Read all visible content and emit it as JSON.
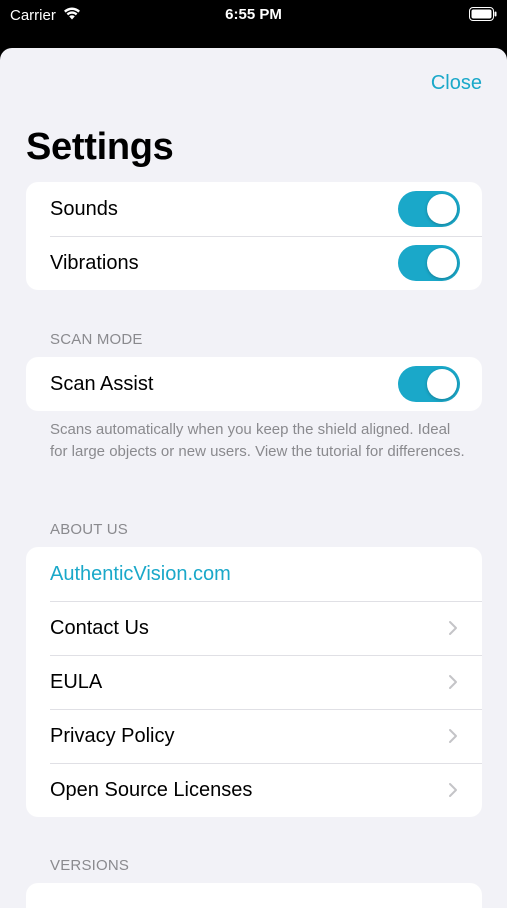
{
  "status_bar": {
    "carrier": "Carrier",
    "time": "6:55 PM",
    "wifi_icon": "wifi-icon",
    "battery_icon": "battery-icon"
  },
  "header": {
    "close_label": "Close",
    "title": "Settings"
  },
  "general": {
    "items": [
      {
        "label": "Sounds",
        "enabled": true
      },
      {
        "label": "Vibrations",
        "enabled": true
      }
    ]
  },
  "scan_mode": {
    "header": "SCAN MODE",
    "items": [
      {
        "label": "Scan Assist",
        "enabled": true
      }
    ],
    "footnote": "Scans automatically when you keep the shield aligned. Ideal for large objects or new users. View the tutorial for differences."
  },
  "about_us": {
    "header": "ABOUT US",
    "link": "AuthenticVision.com",
    "items": [
      {
        "label": "Contact Us"
      },
      {
        "label": "EULA"
      },
      {
        "label": "Privacy Policy"
      },
      {
        "label": "Open Source Licenses"
      }
    ]
  },
  "versions": {
    "header": "VERSIONS"
  },
  "colors": {
    "accent": "#1aa8c9",
    "background": "#f2f2f7",
    "secondary_text": "#8a8a8e"
  }
}
